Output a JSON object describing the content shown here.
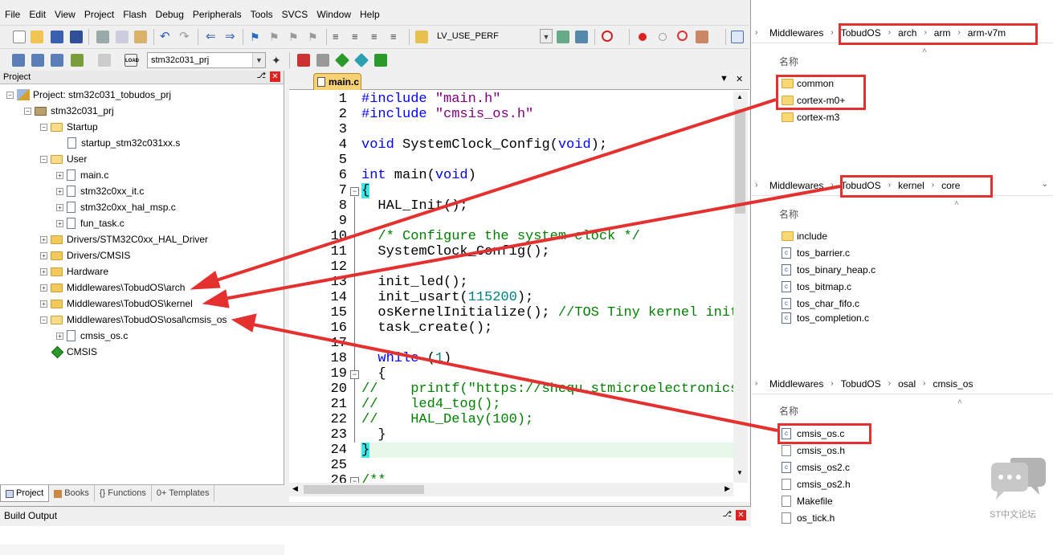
{
  "menu": [
    "File",
    "Edit",
    "View",
    "Project",
    "Flash",
    "Debug",
    "Peripherals",
    "Tools",
    "SVCS",
    "Window",
    "Help"
  ],
  "toolbar": {
    "find_value": "LV_USE_PERF",
    "target_value": "stm32c031_prj"
  },
  "project_panel": {
    "title": "Project",
    "tree": [
      {
        "label": "Project: stm32c031_tobudos_prj"
      },
      {
        "label": "stm32c031_prj"
      },
      {
        "label": "Startup"
      },
      {
        "label": "startup_stm32c031xx.s"
      },
      {
        "label": "User"
      },
      {
        "label": "main.c"
      },
      {
        "label": "stm32c0xx_it.c"
      },
      {
        "label": "stm32c0xx_hal_msp.c"
      },
      {
        "label": "fun_task.c"
      },
      {
        "label": "Drivers/STM32C0xx_HAL_Driver"
      },
      {
        "label": "Drivers/CMSIS"
      },
      {
        "label": "Hardware"
      },
      {
        "label": "Middlewares\\TobudOS\\arch"
      },
      {
        "label": "Middlewares\\TobudOS\\kernel"
      },
      {
        "label": "Middlewares\\TobudOS\\osal\\cmsis_os"
      },
      {
        "label": "cmsis_os.c"
      },
      {
        "label": "CMSIS"
      }
    ],
    "tabs": [
      "Project",
      "Books",
      "{} Functions",
      "0+ Templates"
    ]
  },
  "editor": {
    "tab": "main.c",
    "lines": [
      {
        "n": "1"
      },
      {
        "n": "2"
      },
      {
        "n": "3"
      },
      {
        "n": "4"
      },
      {
        "n": "5"
      },
      {
        "n": "6"
      },
      {
        "n": "7"
      },
      {
        "n": "8"
      },
      {
        "n": "9"
      },
      {
        "n": "10"
      },
      {
        "n": "11"
      },
      {
        "n": "12"
      },
      {
        "n": "13"
      },
      {
        "n": "14"
      },
      {
        "n": "15"
      },
      {
        "n": "16"
      },
      {
        "n": "17"
      },
      {
        "n": "18"
      },
      {
        "n": "19"
      },
      {
        "n": "20"
      },
      {
        "n": "21"
      },
      {
        "n": "22"
      },
      {
        "n": "23"
      },
      {
        "n": "24"
      },
      {
        "n": "25"
      },
      {
        "n": "26"
      }
    ],
    "code": {
      "l1a": "#include ",
      "l1b": "\"main.h\"",
      "l2a": "#include ",
      "l2b": "\"cmsis_os.h\"",
      "l4a": "void",
      "l4b": " SystemClock_Config(",
      "l4c": "void",
      "l4d": ");",
      "l6a": "int",
      "l6b": " main(",
      "l6c": "void",
      "l6d": ")",
      "l7": "{",
      "l8": "  HAL_Init();",
      "l10": "  /* Configure the system clock */",
      "l11": "  SystemClock_Config();",
      "l13": "  init_led();",
      "l14a": "  init_usart(",
      "l14b": "115200",
      "l14c": ");",
      "l15a": "  osKernelInitialize(); ",
      "l15b": "//TOS Tiny kernel initialize",
      "l16": "  task_create();",
      "l18a": "  while",
      "l18b": " (",
      "l18c": "1",
      "l18d": ")",
      "l19": "  {",
      "l20a": "//    printf(",
      "l20b": "\"https://shequ.stmicroelectronics.cn/\"",
      "l21": "//    led4_tog();",
      "l22": "//    HAL_Delay(100);",
      "l23": "  }",
      "l24": "}",
      "l26": "/**"
    }
  },
  "build_output": {
    "title": "Build Output"
  },
  "explorer": {
    "column_name": "名称",
    "pane1": {
      "crumbs": [
        "Middlewares",
        "TobudOS",
        "arch",
        "arm",
        "arm-v7m"
      ],
      "items": [
        "common",
        "cortex-m0+",
        "cortex-m3"
      ]
    },
    "pane2": {
      "crumbs": [
        "Middlewares",
        "TobudOS",
        "kernel",
        "core"
      ],
      "items": [
        "include",
        "tos_barrier.c",
        "tos_binary_heap.c",
        "tos_bitmap.c",
        "tos_char_fifo.c",
        "tos_completion.c"
      ]
    },
    "pane3": {
      "crumbs": [
        "Middlewares",
        "TobudOS",
        "osal",
        "cmsis_os"
      ],
      "items": [
        "cmsis_os.c",
        "cmsis_os.h",
        "cmsis_os2.c",
        "cmsis_os2.h",
        "Makefile",
        "os_tick.h"
      ]
    }
  },
  "watermark": "ST中文论坛",
  "colors": {
    "annotation_red": "#e53030",
    "keyword_blue": "#0000ff",
    "comment_green": "#008000",
    "string_purple": "#800080"
  }
}
